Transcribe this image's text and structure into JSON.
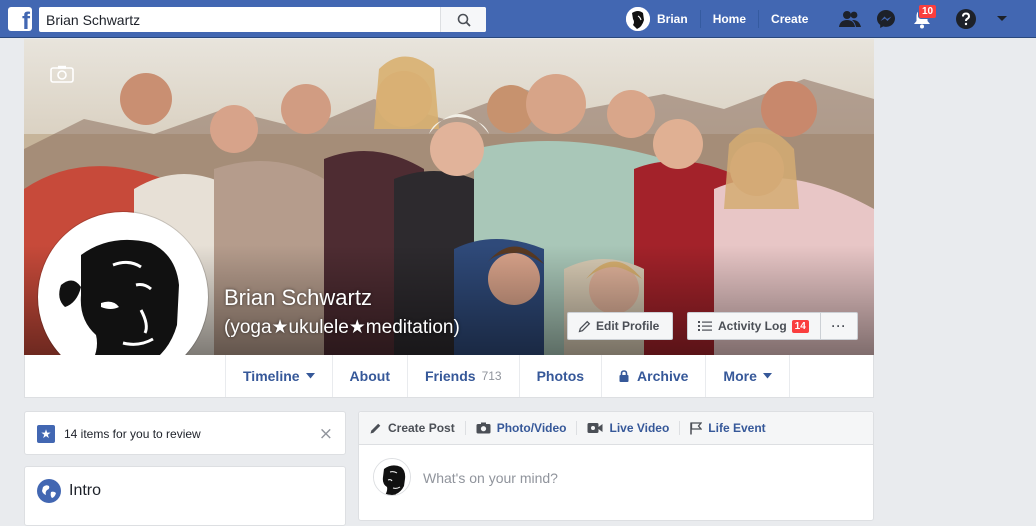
{
  "topbar": {
    "logo_letter": "f",
    "search_value": "Brian Schwartz",
    "user_name": "Brian",
    "home_label": "Home",
    "create_label": "Create",
    "notifications_count": "10"
  },
  "profile": {
    "name": "Brian Schwartz",
    "alternate_name": "(yoga★ukulele★meditation)",
    "edit_profile_label": "Edit Profile",
    "activity_log_label": "Activity Log",
    "activity_log_count": "14",
    "more_label": "···"
  },
  "tabs": [
    {
      "label": "Timeline"
    },
    {
      "label": "About"
    },
    {
      "label": "Friends",
      "count": "713"
    },
    {
      "label": "Photos"
    },
    {
      "label": "Archive"
    },
    {
      "label": "More"
    }
  ],
  "review": {
    "text": "14 items for you to review",
    "close_glyph": "×",
    "star_glyph": "★"
  },
  "intro": {
    "title": "Intro"
  },
  "composer": {
    "create_post": "Create Post",
    "photo_video": "Photo/Video",
    "live_video": "Live Video",
    "life_event": "Life Event",
    "placeholder": "What's on your mind?"
  },
  "colors": {
    "brand": "#4267b2",
    "link": "#365899",
    "badge": "#fa3e3e"
  }
}
